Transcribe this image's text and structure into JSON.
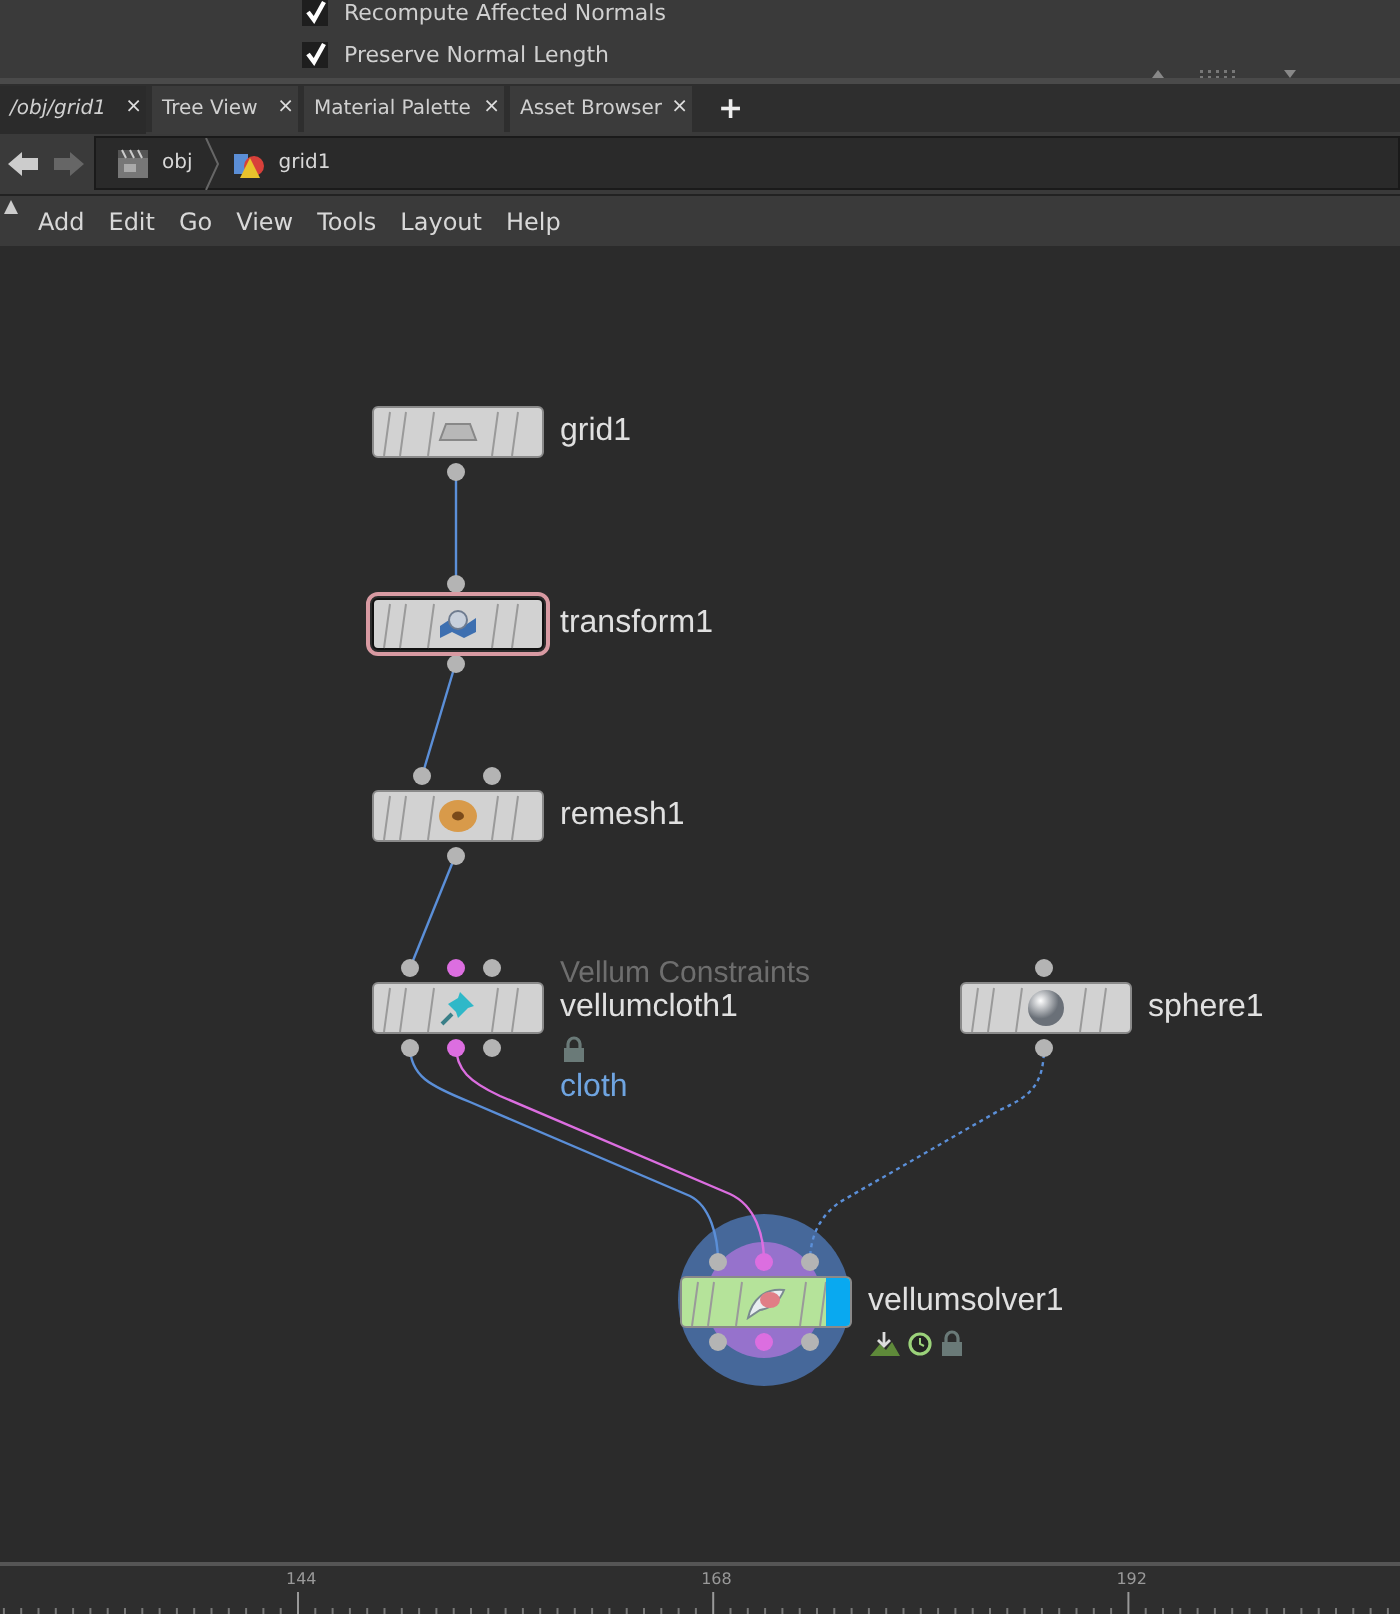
{
  "parameters": [
    {
      "label": "Recompute Affected Normals",
      "checked": true
    },
    {
      "label": "Preserve Normal Length",
      "checked": true
    }
  ],
  "tabs": [
    {
      "label": "/obj/grid1",
      "close": "×",
      "selected": true
    },
    {
      "label": "Tree View",
      "close": "×",
      "selected": false
    },
    {
      "label": "Material Palette",
      "close": "×",
      "selected": false
    },
    {
      "label": "Asset Browser",
      "close": "×",
      "selected": false
    }
  ],
  "new_tab": "+",
  "path": [
    {
      "label": "obj",
      "kind": "obj"
    },
    {
      "label": "grid1",
      "kind": "geo"
    }
  ],
  "menu": [
    "Add",
    "Edit",
    "Go",
    "View",
    "Tools",
    "Layout",
    "Help"
  ],
  "nodes": [
    {
      "name": "grid1",
      "kind": "grid",
      "color": "#d2d2d2",
      "selected": false,
      "display": false,
      "highlighted": false,
      "locked": false
    },
    {
      "name": "transform1",
      "kind": "transform",
      "color": "#d2d2d2",
      "selected": true,
      "display": false,
      "highlighted": false,
      "locked": false
    },
    {
      "name": "remesh1",
      "kind": "remesh",
      "color": "#d2d2d2",
      "selected": false,
      "display": false,
      "highlighted": false,
      "locked": false
    },
    {
      "name": "vellumcloth1",
      "kind": "pin",
      "color": "#d2d2d2",
      "descriptor": "Vellum Constraints",
      "group": "cloth",
      "selected": false,
      "display": false,
      "highlighted": false,
      "locked": true
    },
    {
      "name": "sphere1",
      "kind": "sphere",
      "color": "#d2d2d2",
      "selected": false,
      "display": false,
      "highlighted": false,
      "locked": false
    },
    {
      "name": "vellumsolver1",
      "kind": "solver",
      "color": "#b5e39a",
      "selected": false,
      "display": true,
      "highlighted": true,
      "locked": true
    }
  ],
  "timeline": {
    "ticks": [
      "144",
      "168",
      "192"
    ]
  }
}
